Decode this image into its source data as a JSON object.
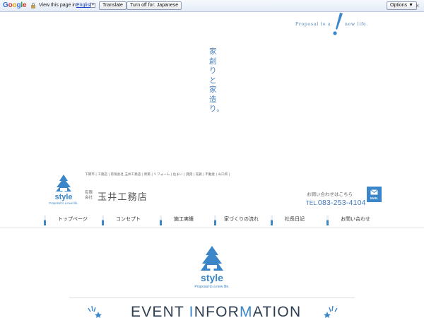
{
  "translate_bar": {
    "logo": "Google",
    "view_text": "View this page in:",
    "language": "English",
    "dropdown_glyph": "▾",
    "translate_label": "Translate",
    "turnoff_label": "Turn off for: Japanese",
    "options_label": "Options ▼",
    "close_glyph": "×"
  },
  "tagline": {
    "part1": "Proposal to a",
    "part2": "new life."
  },
  "catchphrase": "家創りと家造り。",
  "header": {
    "tags": "下関市 | 工務店 | 有限会社 玉井工務店 | 新築 | リフォーム | 住まい | 貸貸 | 売買 | 不動産 | 山口県 |",
    "logo_text": "style",
    "logo_tagline": "Proposal to a new life.",
    "company_type": "有限会社",
    "company_name": "玉井工務店",
    "contact_label": "お問い合わせはこちら",
    "tel_prefix": "TEL.",
    "tel_number": "083-253-4104",
    "mail_label": "MAIL"
  },
  "nav": {
    "items": [
      {
        "label": "トップページ"
      },
      {
        "label": "コンセプト"
      },
      {
        "label": "施工実績"
      },
      {
        "label": "家づくりの流れ"
      },
      {
        "label": "社長日記"
      },
      {
        "label": "お問い合わせ"
      }
    ]
  },
  "main": {
    "logo_text": "style",
    "logo_tagline": "Proposal to a new life.",
    "event_title": {
      "p1": "EVENT ",
      "h1": "I",
      "p2": "NFOR",
      "h2": "M",
      "p3": "ATION"
    }
  },
  "colors": {
    "accent": "#3b86c9",
    "text": "#333333",
    "heading": "#2f3f52"
  }
}
